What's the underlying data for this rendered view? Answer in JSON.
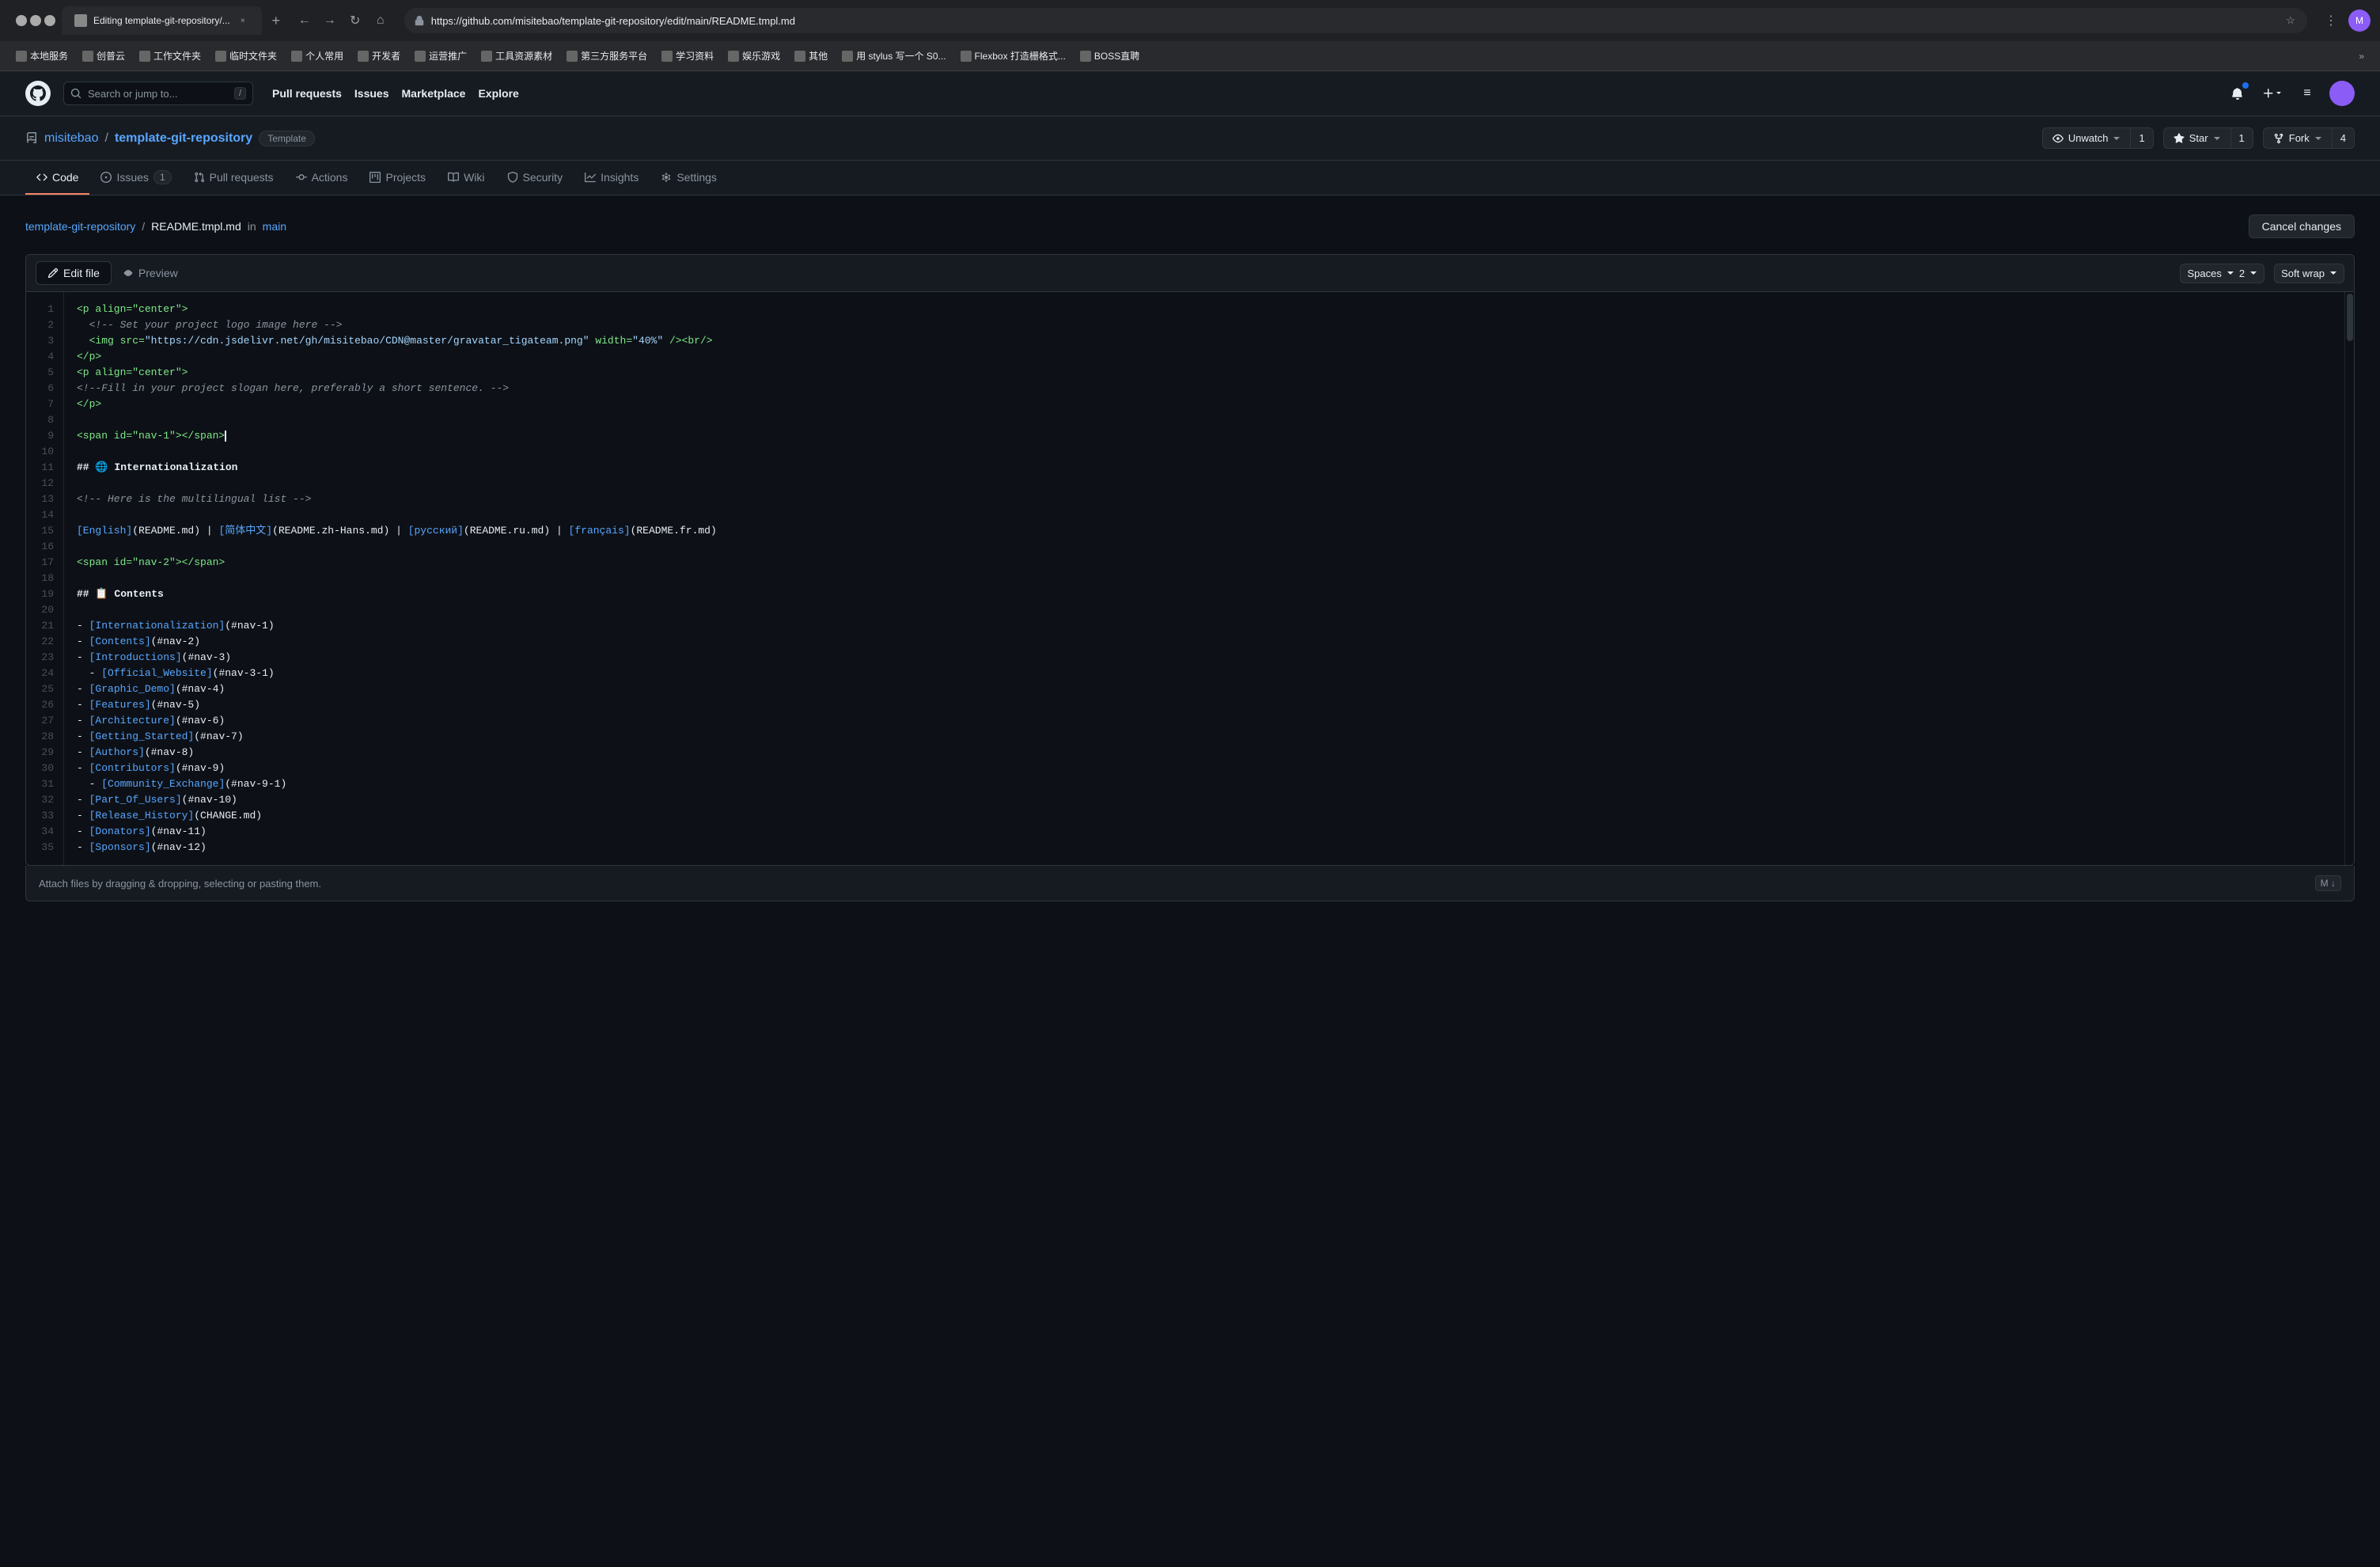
{
  "browser": {
    "tab_title": "Editing template-git-repository/...",
    "tab_close": "×",
    "new_tab": "+",
    "back": "←",
    "forward": "→",
    "refresh": "↻",
    "home": "⌂",
    "address": "https://github.com/misitebao/template-git-repository/edit/main/README.tmpl.md",
    "win_min": "−",
    "win_max": "□",
    "win_close": "×"
  },
  "bookmarks": [
    {
      "label": "本地服务"
    },
    {
      "label": "创普云"
    },
    {
      "label": "工作文件夹"
    },
    {
      "label": "临时文件夹"
    },
    {
      "label": "个人常用"
    },
    {
      "label": "开发者"
    },
    {
      "label": "运营推广"
    },
    {
      "label": "工具资源素材"
    },
    {
      "label": "第三方服务平台"
    },
    {
      "label": "学习资料"
    },
    {
      "label": "娱乐游戏"
    },
    {
      "label": "其他"
    },
    {
      "label": "用 stylus 写一个 S0..."
    },
    {
      "label": "Flexbox 打造栅格式..."
    },
    {
      "label": "BOSS直聘"
    }
  ],
  "github": {
    "search_placeholder": "Search or jump to...",
    "search_kbd": "/",
    "nav": [
      {
        "label": "Pull requests"
      },
      {
        "label": "Issues"
      },
      {
        "label": "Marketplace"
      },
      {
        "label": "Explore"
      }
    ]
  },
  "repo": {
    "owner": "misitebao",
    "separator": "/",
    "name": "template-git-repository",
    "template_badge": "Template",
    "watch_label": "Unwatch",
    "watch_count": "1",
    "star_label": "Star",
    "star_count": "1",
    "fork_label": "Fork",
    "fork_count": "4",
    "tabs": [
      {
        "label": "Code",
        "icon": "<>",
        "active": true,
        "badge": null
      },
      {
        "label": "Issues",
        "icon": "○",
        "active": false,
        "badge": "1"
      },
      {
        "label": "Pull requests",
        "icon": "⑂",
        "active": false,
        "badge": null
      },
      {
        "label": "Actions",
        "icon": "▷",
        "active": false,
        "badge": null
      },
      {
        "label": "Projects",
        "icon": "⊞",
        "active": false,
        "badge": null
      },
      {
        "label": "Wiki",
        "icon": "≡",
        "active": false,
        "badge": null
      },
      {
        "label": "Security",
        "icon": "⚑",
        "active": false,
        "badge": null
      },
      {
        "label": "Insights",
        "icon": "≈",
        "active": false,
        "badge": null
      },
      {
        "label": "Settings",
        "icon": "⚙",
        "active": false,
        "badge": null
      }
    ]
  },
  "editor": {
    "breadcrumb_repo": "template-git-repository",
    "breadcrumb_file": "README.tmpl.md",
    "breadcrumb_branch_prefix": "in",
    "breadcrumb_branch": "main",
    "cancel_label": "Cancel changes",
    "edit_tab": "Edit file",
    "preview_tab": "Preview",
    "spaces_label": "Spaces",
    "spaces_value": "2",
    "softwrap_label": "Soft wrap",
    "footer_text": "Attach files by dragging & dropping, selecting or pasting them.",
    "lines": [
      {
        "num": "1",
        "content": "<p align=\"center\">",
        "type": "tag"
      },
      {
        "num": "2",
        "content": "  <!-- Set your project logo image here -->",
        "type": "comment"
      },
      {
        "num": "3",
        "content": "  <img src=\"https://cdn.jsdelivr.net/gh/misitebao/CDN@master/gravatar_tigateam.png\" width=\"40%\" /><br/>",
        "type": "mixed"
      },
      {
        "num": "4",
        "content": "</p>",
        "type": "tag"
      },
      {
        "num": "5",
        "content": "<p align=\"center\">",
        "type": "tag"
      },
      {
        "num": "6",
        "content": "<!--Fill in your project slogan here, preferably a short sentence. -->",
        "type": "comment"
      },
      {
        "num": "7",
        "content": "</p>",
        "type": "tag"
      },
      {
        "num": "8",
        "content": "",
        "type": "empty"
      },
      {
        "num": "9",
        "content": "<span id=\"nav-1\"></span>",
        "type": "tag"
      },
      {
        "num": "10",
        "content": "",
        "type": "empty"
      },
      {
        "num": "11",
        "content": "## 🌐 Internationalization",
        "type": "heading"
      },
      {
        "num": "12",
        "content": "",
        "type": "empty"
      },
      {
        "num": "13",
        "content": "<!-- Here is the multilingual list -->",
        "type": "comment"
      },
      {
        "num": "14",
        "content": "",
        "type": "empty"
      },
      {
        "num": "15",
        "content": "[English](README.md) | [简体中文](README.zh-Hans.md) | [русский](README.ru.md) | [français](README.fr.md)",
        "type": "links"
      },
      {
        "num": "16",
        "content": "",
        "type": "empty"
      },
      {
        "num": "17",
        "content": "<span id=\"nav-2\"></span>",
        "type": "tag"
      },
      {
        "num": "18",
        "content": "",
        "type": "empty"
      },
      {
        "num": "19",
        "content": "## 📋 Contents",
        "type": "heading"
      },
      {
        "num": "20",
        "content": "",
        "type": "empty"
      },
      {
        "num": "21",
        "content": "- [Internationalization](#nav-1)",
        "type": "list"
      },
      {
        "num": "22",
        "content": "- [Contents](#nav-2)",
        "type": "list"
      },
      {
        "num": "23",
        "content": "- [Introductions](#nav-3)",
        "type": "list"
      },
      {
        "num": "24",
        "content": "  - [Official_Website](#nav-3-1)",
        "type": "list"
      },
      {
        "num": "25",
        "content": "- [Graphic_Demo](#nav-4)",
        "type": "list"
      },
      {
        "num": "26",
        "content": "- [Features](#nav-5)",
        "type": "list"
      },
      {
        "num": "27",
        "content": "- [Architecture](#nav-6)",
        "type": "list"
      },
      {
        "num": "28",
        "content": "- [Getting_Started](#nav-7)",
        "type": "list"
      },
      {
        "num": "29",
        "content": "- [Authors](#nav-8)",
        "type": "list"
      },
      {
        "num": "30",
        "content": "- [Contributors](#nav-9)",
        "type": "list"
      },
      {
        "num": "31",
        "content": "  - [Community_Exchange](#nav-9-1)",
        "type": "list"
      },
      {
        "num": "32",
        "content": "- [Part_Of_Users](#nav-10)",
        "type": "list"
      },
      {
        "num": "33",
        "content": "- [Release_History](CHANGE.md)",
        "type": "list"
      },
      {
        "num": "34",
        "content": "- [Donators](#nav-11)",
        "type": "list"
      },
      {
        "num": "35",
        "content": "- [Sponsors](#nav-12)",
        "type": "list"
      }
    ]
  }
}
